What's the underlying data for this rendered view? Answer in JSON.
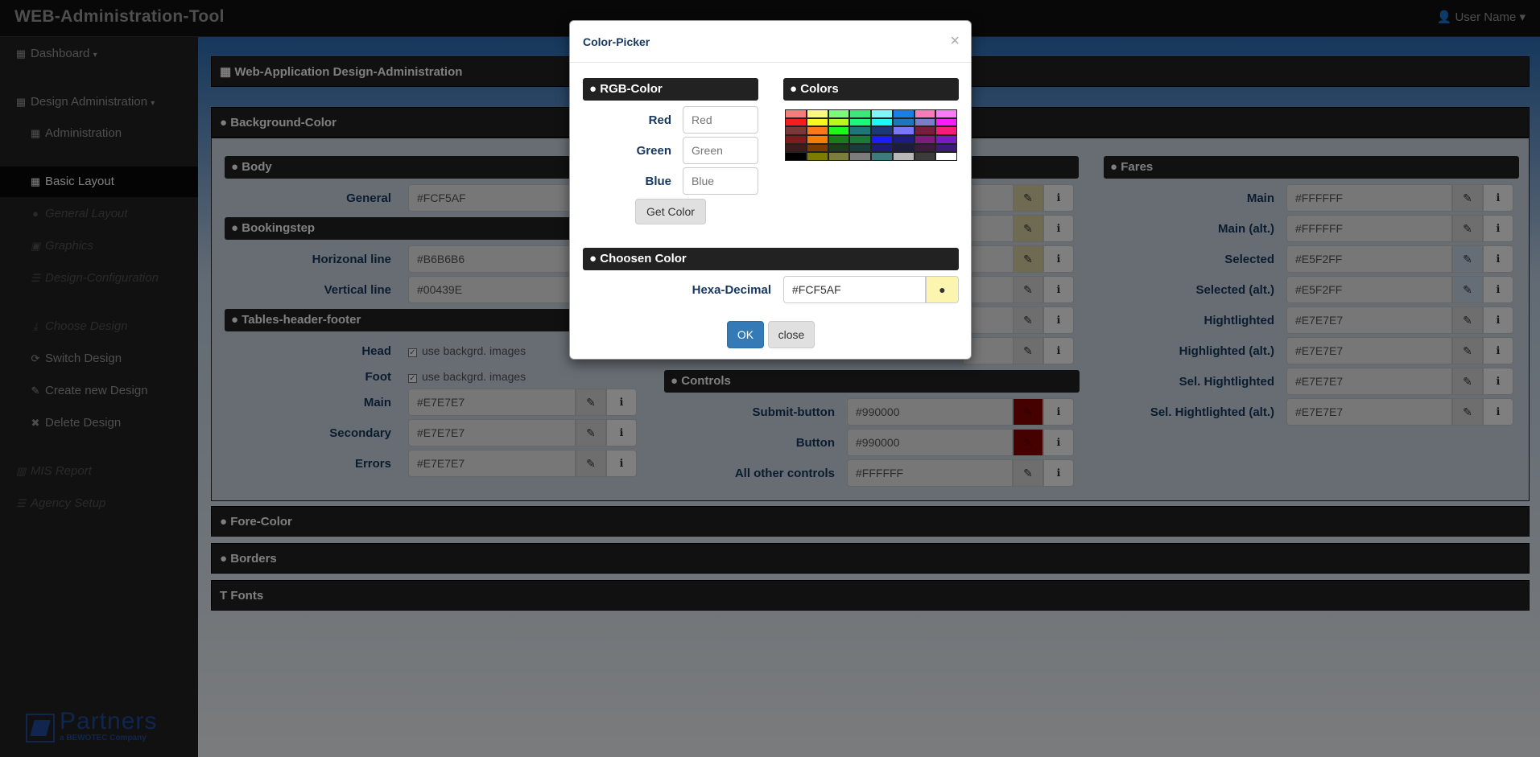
{
  "app": {
    "title": "WEB-Administration-Tool",
    "user": "User Name"
  },
  "sidebar": {
    "items": [
      {
        "label": "Dashboard",
        "icon": "table-icon",
        "caret": true
      },
      {
        "label": "Design Administration",
        "icon": "table-icon",
        "caret": true
      },
      {
        "label": "Administration",
        "icon": "grid-icon"
      },
      {
        "label": "Basic Layout",
        "icon": "grid-icon"
      },
      {
        "label": "General Layout",
        "icon": "droplet-icon"
      },
      {
        "label": "Graphics",
        "icon": "picture-icon"
      },
      {
        "label": "Design-Configuration",
        "icon": "list-icon"
      },
      {
        "label": "Choose Design",
        "icon": "download-icon"
      },
      {
        "label": "Switch Design",
        "icon": "refresh-icon"
      },
      {
        "label": "Create new Design",
        "icon": "edit-icon"
      },
      {
        "label": "Delete Design",
        "icon": "remove-icon"
      },
      {
        "label": "MIS Report",
        "icon": "bar-chart-icon"
      },
      {
        "label": "Agency Setup",
        "icon": "list-icon"
      }
    ],
    "logo": {
      "word": "Partners",
      "sub": "a BEWOTEC Company"
    }
  },
  "main": {
    "page_title": "Web-Application Design-Administration",
    "panels": {
      "background": "Background-Color",
      "fore": "Fore-Color",
      "borders": "Borders",
      "fonts": "Fonts"
    },
    "body": {
      "title": "Body",
      "general_label": "General",
      "general_value": "#FCF5AF"
    },
    "bookingstep": {
      "title": "Bookingstep",
      "horizontal_label": "Horizonal line",
      "horizontal_value": "#B6B6B6",
      "vertical_label": "Vertical line",
      "vertical_value": "#00439E"
    },
    "tables": {
      "title": "Tables-header-footer",
      "head_label": "Head",
      "head_check": "use backgrd. images",
      "foot_label": "Foot",
      "foot_check": "use backgrd. images",
      "main_label": "Main",
      "main_value": "#E7E7E7",
      "secondary_label": "Secondary",
      "secondary_value": "#E7E7E7",
      "errors_label": "Errors",
      "errors_value": "#E7E7E7"
    },
    "controls": {
      "title": "Controls",
      "submit_label": "Submit-button",
      "submit_value": "#990000",
      "button_label": "Button",
      "button_value": "#990000",
      "other_label": "All other controls",
      "other_value": "#FFFFFF"
    },
    "fares": {
      "title": "Fares",
      "rows": [
        {
          "label": "Main",
          "value": "#FFFFFF"
        },
        {
          "label": "Main (alt.)",
          "value": "#FFFFFF"
        },
        {
          "label": "Selected",
          "value": "#E5F2FF"
        },
        {
          "label": "Selected (alt.)",
          "value": "#E5F2FF"
        },
        {
          "label": "Hightlighted",
          "value": "#E7E7E7"
        },
        {
          "label": "Highlighted (alt.)",
          "value": "#E7E7E7"
        },
        {
          "label": "Sel. Hightlighted",
          "value": "#E7E7E7"
        },
        {
          "label": "Sel. Hightlighted (alt.)",
          "value": "#E7E7E7"
        }
      ]
    }
  },
  "modal": {
    "title": "Color-Picker",
    "close_x": "×",
    "rgb_title": "RGB-Color",
    "red_label": "Red",
    "red_placeholder": "Red",
    "green_label": "Green",
    "green_placeholder": "Green",
    "blue_label": "Blue",
    "blue_placeholder": "Blue",
    "get_color": "Get Color",
    "colors_title": "Colors",
    "chosen_title": "Choosen Color",
    "hex_label": "Hexa-Decimal",
    "hex_value": "#FCF5AF",
    "ok": "OK",
    "close": "close",
    "palette": [
      "#f87c7c",
      "#f8f87c",
      "#7cf87c",
      "#38e878",
      "#7cf8f8",
      "#1c7ce8",
      "#f87cb8",
      "#f87cf8",
      "#f81c1c",
      "#f8f81c",
      "#b8f81c",
      "#1cf878",
      "#1cf8f8",
      "#1c78b8",
      "#7c7cc8",
      "#f81cf8",
      "#7c3838",
      "#f8781c",
      "#1cf81c",
      "#1c7878",
      "#1c3878",
      "#7878f8",
      "#7c1c3c",
      "#f81c78",
      "#7c1c1c",
      "#f87c00",
      "#1c7c1c",
      "#1c7838",
      "#1c1cf8",
      "#1c1c7c",
      "#7c1c7c",
      "#781cc8",
      "#3c1c1c",
      "#7c3c00",
      "#1c3c1c",
      "#1c3c3c",
      "#1c1c7c",
      "#1c1c3c",
      "#3c1c3c",
      "#3c1c78",
      "#000000",
      "#7c7c00",
      "#7c7c3c",
      "#7c7c7c",
      "#3c7c7c",
      "#b8b8b8",
      "#3c3c3c",
      "#ffffff"
    ]
  },
  "colors": {
    "accent": "#337ab7",
    "navbar": "#111111",
    "label": "#17375e",
    "dark_red": "#990000",
    "highlight": "#FCF5AF"
  }
}
